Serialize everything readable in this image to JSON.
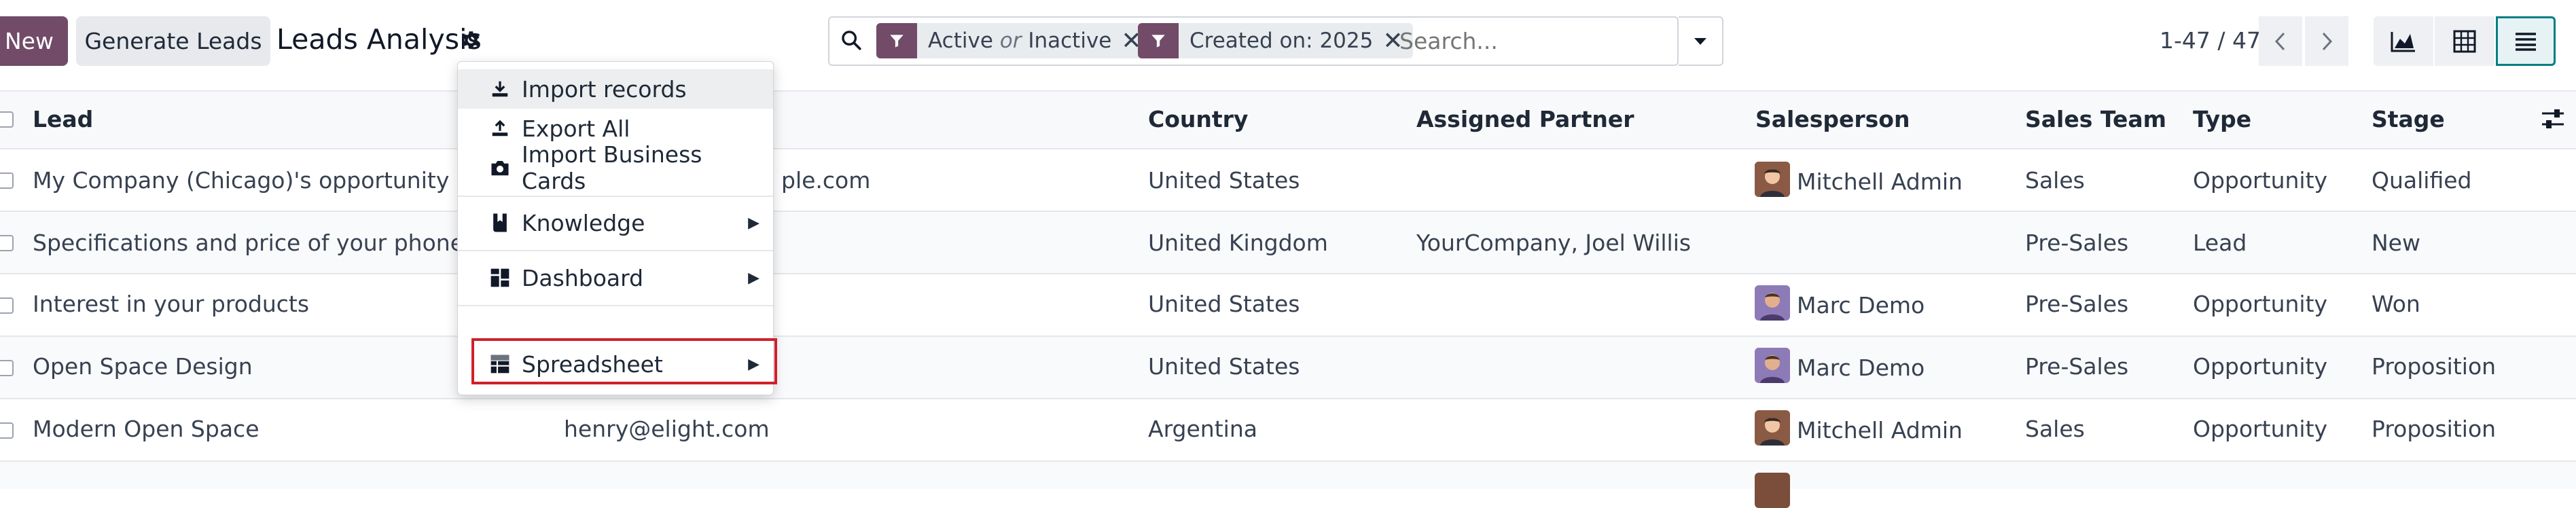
{
  "control_panel": {
    "new_label": "New",
    "generate_label": "Generate Leads",
    "title": "Leads Analysis"
  },
  "search": {
    "facet1_a": "Active",
    "facet1_or": "or",
    "facet1_b": "Inactive",
    "facet2": "Created on: 2025",
    "placeholder": "Search..."
  },
  "pager": {
    "value": "1-47 / 47"
  },
  "columns": {
    "lead": "Lead",
    "country": "Country",
    "partner": "Assigned Partner",
    "salesperson": "Salesperson",
    "team": "Sales Team",
    "type": "Type",
    "stage": "Stage"
  },
  "rows": [
    {
      "lead": "My Company (Chicago)'s opportunity",
      "email": "ple.com",
      "country": "United States",
      "partner": "",
      "salesperson": "Mitchell Admin",
      "team": "Sales",
      "type": "Opportunity",
      "stage": "Qualified"
    },
    {
      "lead": "Specifications and price of your phones",
      "email": "",
      "country": "United Kingdom",
      "partner": "YourCompany, Joel Willis",
      "salesperson": "",
      "team": "Pre-Sales",
      "type": "Lead",
      "stage": "New"
    },
    {
      "lead": "Interest in your products",
      "email": "",
      "country": "United States",
      "partner": "",
      "salesperson": "Marc Demo",
      "team": "Pre-Sales",
      "type": "Opportunity",
      "stage": "Won"
    },
    {
      "lead": "Open Space Design",
      "email": "",
      "country": "United States",
      "partner": "",
      "salesperson": "Marc Demo",
      "team": "Pre-Sales",
      "type": "Opportunity",
      "stage": "Proposition"
    },
    {
      "lead": "Modern Open Space",
      "email": "henry@elight.com",
      "country": "Argentina",
      "partner": "",
      "salesperson": "Mitchell Admin",
      "team": "Sales",
      "type": "Opportunity",
      "stage": "Proposition"
    }
  ],
  "menu": {
    "import": "Import records",
    "export": "Export All",
    "cards": "Import Business Cards",
    "knowledge": "Knowledge",
    "dashboard": "Dashboard",
    "spreadsheet": "Spreadsheet"
  },
  "colors": {
    "brand": "#714B67",
    "highlight": "#d0202a"
  }
}
